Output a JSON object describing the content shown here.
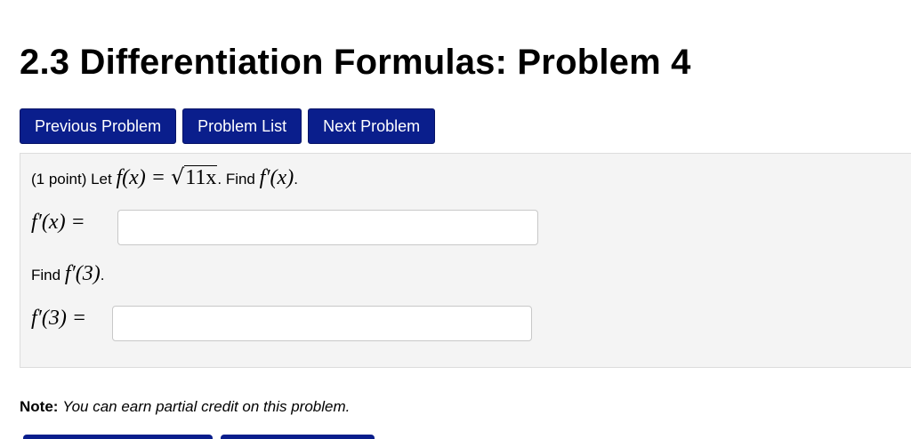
{
  "page": {
    "title": "2.3 Differentiation Formulas: Problem 4"
  },
  "nav": {
    "previous_label": "Previous Problem",
    "list_label": "Problem List",
    "next_label": "Next Problem"
  },
  "problem": {
    "points_text": "(1 point) Let",
    "function_lhs": "f(x) =",
    "radicand": "11x",
    "find_text": ". Find",
    "find_expr": "f′(x)",
    "period": ".",
    "answer1_label": "f′(x) =",
    "answer1_value": "",
    "find2_text": "Find",
    "find2_expr": "f′(3)",
    "answer2_label": "f′(3) =",
    "answer2_value": ""
  },
  "note": {
    "label": "Note:",
    "text": "You can earn partial credit on this problem."
  },
  "colors": {
    "button_bg": "#0a1e8c",
    "panel_bg": "#f4f4f4"
  }
}
